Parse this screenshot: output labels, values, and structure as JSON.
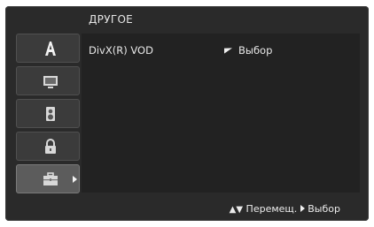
{
  "header": {
    "title": "ДРУГОЕ"
  },
  "menu": {
    "items": [
      {
        "label": "DivX(R) VOD",
        "value": "Выбор"
      }
    ]
  },
  "tabs": [
    {
      "icon": "letter-a-icon"
    },
    {
      "icon": "tv-screen-icon"
    },
    {
      "icon": "speaker-icon"
    },
    {
      "icon": "padlock-icon"
    },
    {
      "icon": "briefcase-icon",
      "selected": true
    }
  ],
  "footer": {
    "move_label": "Перемещ.",
    "select_label": "Выбор"
  },
  "colors": {
    "background": "#2a2a2a",
    "panel": "#222222",
    "tab": "#3b3b3b",
    "tab_selected": "#5c5c5c",
    "text": "#e8e8e8"
  }
}
